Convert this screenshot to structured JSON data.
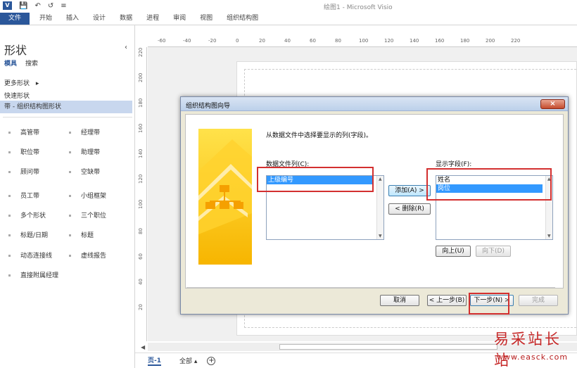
{
  "window": {
    "title": "绘图1 - Microsoft Visio",
    "logo": "V"
  },
  "qat": {
    "icons": [
      "save-icon",
      "undo-icon",
      "redo-icon",
      "customize-icon"
    ]
  },
  "ribbon": {
    "tabs": [
      "文件",
      "开始",
      "插入",
      "设计",
      "数据",
      "进程",
      "审阅",
      "视图",
      "组织结构图"
    ],
    "accent": "#2b579a"
  },
  "shapes_pane": {
    "title": "形状",
    "subtabs": [
      "模具",
      "搜索"
    ],
    "more_shapes": "更多形状",
    "quick_shapes": "快速形状",
    "active_stencil": "带 - 组织结构图形状",
    "shapes": [
      [
        "高管带",
        "经理带"
      ],
      [
        "职位带",
        "助理带"
      ],
      [
        "顾问带",
        "空缺带"
      ],
      [
        "员工带",
        "小组框架"
      ],
      [
        "多个形状",
        "三个职位"
      ],
      [
        "标题/日期",
        "标题"
      ],
      [
        "动态连接线",
        "虚线报告"
      ],
      [
        "直接附属经理"
      ]
    ]
  },
  "rulers": {
    "horizontal": [
      "-60",
      "-40",
      "-20",
      "0",
      "20",
      "40",
      "60",
      "80",
      "100",
      "120",
      "140",
      "160",
      "180",
      "200",
      "220"
    ],
    "vertical": [
      "220",
      "200",
      "180",
      "160",
      "140",
      "120",
      "100",
      "80",
      "60",
      "40",
      "20"
    ]
  },
  "pagebar": {
    "page": "页-1",
    "all": "全部",
    "add": "+"
  },
  "dialog": {
    "title": "组织结构图向导",
    "close": "×",
    "instruction": "从数据文件中选择要显示的列(字段)。",
    "data_columns_label": "数据文件列(C):",
    "data_columns": [
      "上级编号"
    ],
    "display_fields_label": "显示字段(F):",
    "display_fields": [
      "姓名",
      "岗位"
    ],
    "add_button": "添加(A) >",
    "remove_button": "< 删除(R)",
    "up_button": "向上(U)",
    "down_button": "向下(D)",
    "cancel_button": "取消",
    "back_button": "< 上一步(B)",
    "next_button": "下一步(N) >",
    "finish_button": "完成"
  },
  "highlight_color": "#d32f2f",
  "watermark": {
    "text": "易采站长站",
    "url": "www.easck.com"
  }
}
